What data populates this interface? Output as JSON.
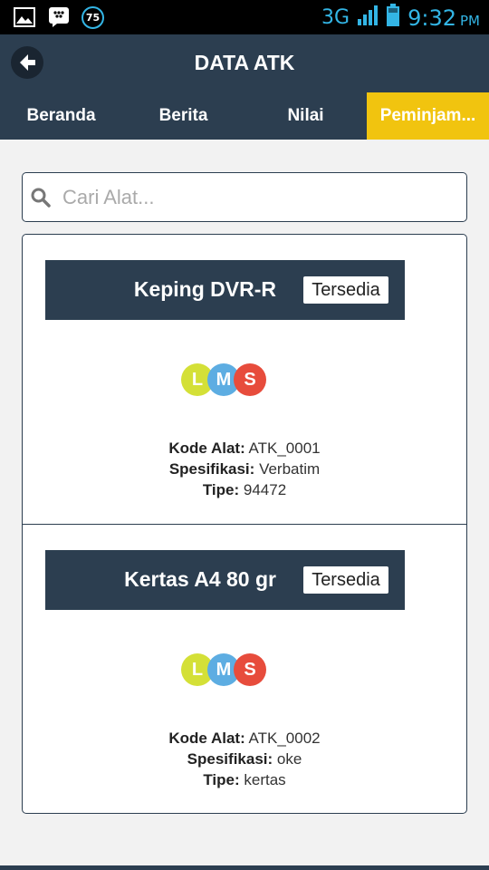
{
  "status_bar": {
    "notification_count": "75",
    "network": "3G",
    "time": "9:32",
    "ampm": "PM"
  },
  "app_bar": {
    "title": "DATA ATK",
    "back_icon": "arrow-left-icon"
  },
  "tabs": [
    {
      "label": "Beranda",
      "active": false
    },
    {
      "label": "Berita",
      "active": false
    },
    {
      "label": "Nilai",
      "active": false
    },
    {
      "label": "Peminjam...",
      "active": true
    }
  ],
  "search": {
    "placeholder": "Cari Alat...",
    "value": ""
  },
  "items": [
    {
      "name": "Keping DVR-R",
      "status": "Tersedia",
      "lms": [
        "L",
        "M",
        "S"
      ],
      "kode_label": "Kode Alat:",
      "kode": "ATK_0001",
      "spesifikasi_label": "Spesifikasi:",
      "spesifikasi": "Verbatim",
      "tipe_label": "Tipe:",
      "tipe": "94472"
    },
    {
      "name": "Kertas A4 80 gr",
      "status": "Tersedia",
      "lms": [
        "L",
        "M",
        "S"
      ],
      "kode_label": "Kode Alat:",
      "kode": "ATK_0002",
      "spesifikasi_label": "Spesifikasi:",
      "spesifikasi": "oke",
      "tipe_label": "Tipe:",
      "tipe": "kertas"
    }
  ],
  "colors": {
    "primary": "#2c3e50",
    "accent": "#f1c40f",
    "status_bar_text": "#33b5e5"
  }
}
